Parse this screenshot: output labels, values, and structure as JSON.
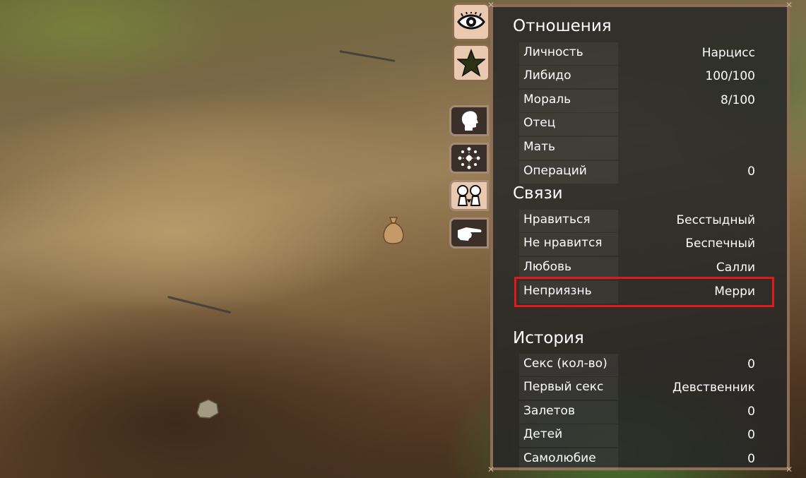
{
  "game_ui": {
    "tabs": [
      {
        "icon": "eye-icon"
      },
      {
        "icon": "star-icon"
      },
      {
        "icon": "head-profile-icon"
      },
      {
        "icon": "skills-network-icon"
      },
      {
        "icon": "relationships-icon"
      },
      {
        "icon": "pointing-hand-icon"
      }
    ],
    "relations": {
      "title": "Отношения",
      "rows": [
        {
          "label": "Личность",
          "value": "Нарцисс"
        },
        {
          "label": "Либидо",
          "value": "100/100"
        },
        {
          "label": "Мораль",
          "value": "8/100"
        },
        {
          "label": "Отец",
          "value": ""
        },
        {
          "label": "Мать",
          "value": ""
        },
        {
          "label": "Операций",
          "value": "0"
        }
      ]
    },
    "links": {
      "title": "Связи",
      "rows": [
        {
          "label": "Нравиться",
          "value": "Бесстыдный"
        },
        {
          "label": "Не нравится",
          "value": "Беспечный"
        },
        {
          "label": "Любовь",
          "value": "Салли"
        },
        {
          "label": "Неприязнь",
          "value": "Мерри"
        }
      ]
    },
    "history": {
      "title": "История",
      "rows": [
        {
          "label": "Секс (кол-во)",
          "value": "0"
        },
        {
          "label": "Первый секс",
          "value": "Девственник"
        },
        {
          "label": "Залетов",
          "value": "0"
        },
        {
          "label": "Детей",
          "value": "0"
        },
        {
          "label": "Самолюбие",
          "value": "0"
        }
      ]
    },
    "colors": {
      "panel_border": "#8d6d55",
      "highlight": "#e0191c",
      "tab_light": "#e9c9b0",
      "tab_dark": "#3b2f29"
    }
  }
}
